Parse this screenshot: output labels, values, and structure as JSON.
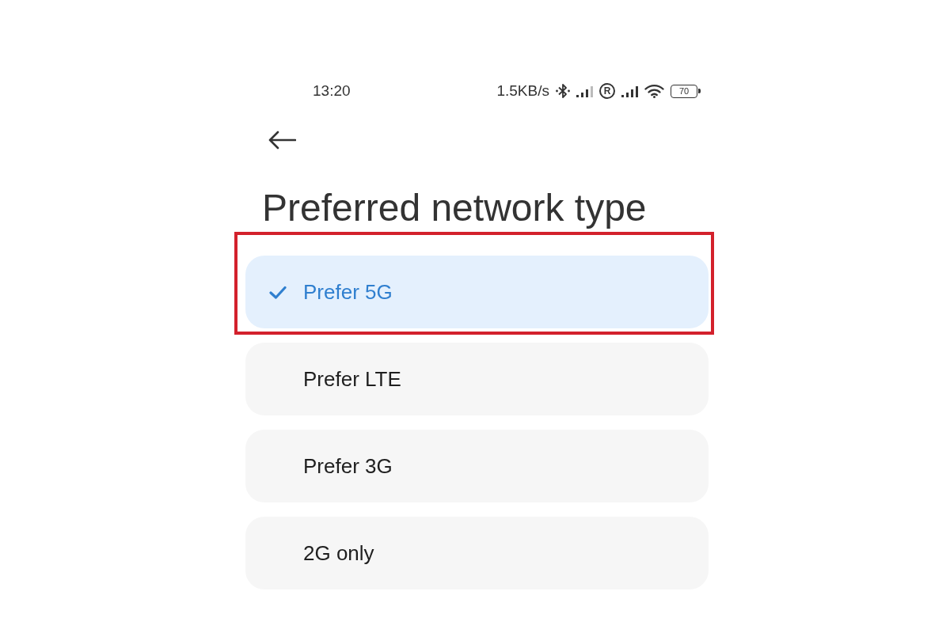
{
  "status_bar": {
    "time": "13:20",
    "network_speed": "1.5KB/s",
    "roaming_mark": "R",
    "battery": "70"
  },
  "title": "Preferred network type",
  "options": [
    {
      "label": "Prefer 5G",
      "selected": true,
      "highlighted": true
    },
    {
      "label": "Prefer LTE",
      "selected": false,
      "highlighted": false
    },
    {
      "label": "Prefer 3G",
      "selected": false,
      "highlighted": false
    },
    {
      "label": "2G only",
      "selected": false,
      "highlighted": false
    }
  ]
}
